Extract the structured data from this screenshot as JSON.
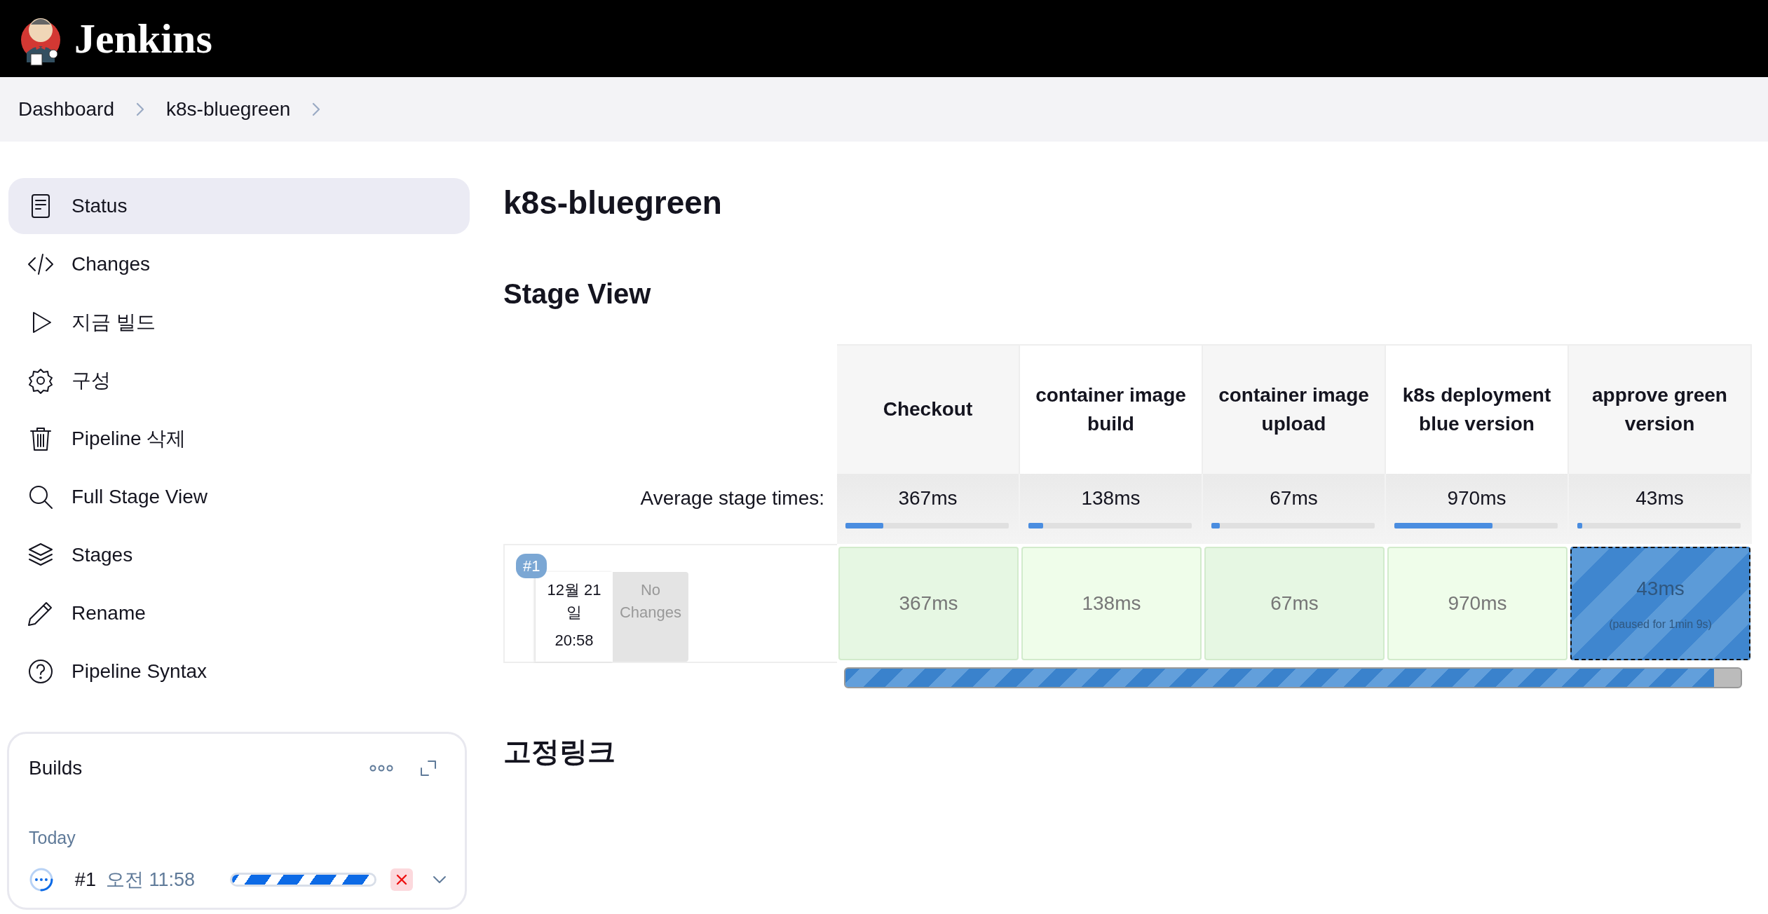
{
  "header": {
    "title": "Jenkins"
  },
  "breadcrumbs": [
    {
      "label": "Dashboard"
    },
    {
      "label": "k8s-bluegreen"
    }
  ],
  "sidebar": {
    "items": [
      {
        "label": "Status",
        "kind": "document",
        "selected": true
      },
      {
        "label": "Changes",
        "kind": "code",
        "selected": false
      },
      {
        "label": "지금 빌드",
        "kind": "play",
        "selected": false
      },
      {
        "label": "구성",
        "kind": "gear",
        "selected": false
      },
      {
        "label": "Pipeline 삭제",
        "kind": "trash",
        "selected": false
      },
      {
        "label": "Full Stage View",
        "kind": "search",
        "selected": false
      },
      {
        "label": "Stages",
        "kind": "layers",
        "selected": false
      },
      {
        "label": "Rename",
        "kind": "pencil",
        "selected": false
      },
      {
        "label": "Pipeline Syntax",
        "kind": "help",
        "selected": false
      }
    ]
  },
  "builds_panel": {
    "title": "Builds",
    "groups": [
      {
        "label": "Today",
        "builds": [
          {
            "number": "#1",
            "time": "오전 11:58",
            "kind": "running",
            "level": 1
          }
        ]
      }
    ]
  },
  "page_title": "k8s-bluegreen",
  "stage_view": {
    "heading": "Stage View",
    "average_label": "Average stage times:",
    "stages": [
      {
        "name": "Checkout",
        "average": "367ms",
        "level": 0.23
      },
      {
        "name": "container image build",
        "average": "138ms",
        "level": 0.09
      },
      {
        "name": "container image upload",
        "average": "67ms",
        "level": 0.05
      },
      {
        "name": "k8s deployment blue version",
        "average": "970ms",
        "level": 0.6
      },
      {
        "name": "approve green version",
        "average": "43ms",
        "level": 0.03
      }
    ],
    "builds": [
      {
        "number": "#1",
        "date": "12월 21 일",
        "time": "20:58",
        "changes": "No Changes",
        "cells": [
          {
            "kind": "success",
            "duration": "367ms"
          },
          {
            "kind": "success",
            "duration": "138ms"
          },
          {
            "kind": "success",
            "duration": "67ms"
          },
          {
            "kind": "success",
            "duration": "970ms"
          },
          {
            "kind": "paused",
            "duration": "43ms",
            "note": "(paused for 1min 9s)"
          }
        ],
        "progress": {
          "level": 0.97
        }
      }
    ]
  },
  "permalinks_heading": "고정링크"
}
